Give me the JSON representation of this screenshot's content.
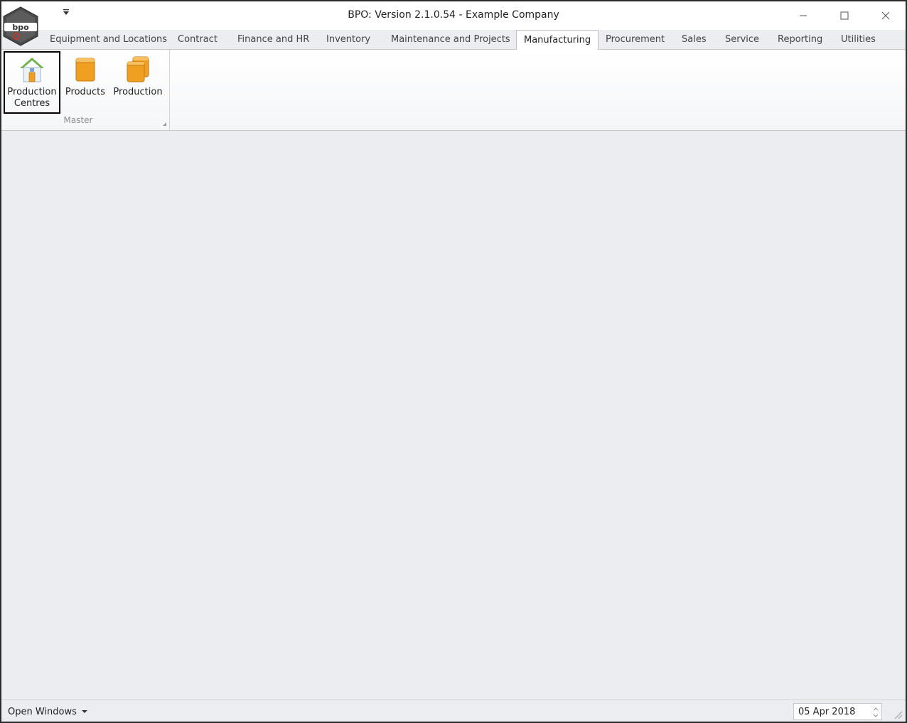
{
  "window": {
    "title": "BPO: Version 2.1.0.54 - Example Company",
    "logo_text": "bpo"
  },
  "qat": {
    "dropdown_icon": "triangle-down-icon"
  },
  "tabs": [
    {
      "label": "Equipment and Locations"
    },
    {
      "label": "Contract"
    },
    {
      "label": "Finance and HR"
    },
    {
      "label": "Inventory"
    },
    {
      "label": "Maintenance and Projects"
    },
    {
      "label": "Manufacturing",
      "active": true
    },
    {
      "label": "Procurement"
    },
    {
      "label": "Sales"
    },
    {
      "label": "Service"
    },
    {
      "label": "Reporting"
    },
    {
      "label": "Utilities"
    }
  ],
  "ribbon": {
    "group_label": "Master",
    "buttons": [
      {
        "line1": "Production",
        "line2": "Centres",
        "icon": "house-icon",
        "selected": true
      },
      {
        "line1": "Products",
        "line2": "",
        "icon": "box-icon"
      },
      {
        "line1": "Production",
        "line2": "",
        "icon": "stacked-boxes-icon"
      }
    ]
  },
  "statusbar": {
    "open_windows_label": "Open Windows",
    "date": "05 Apr 2018"
  },
  "colors": {
    "accent_orange": "#f0a020",
    "house_green": "#6fb34a",
    "background": "#ebedf0"
  }
}
